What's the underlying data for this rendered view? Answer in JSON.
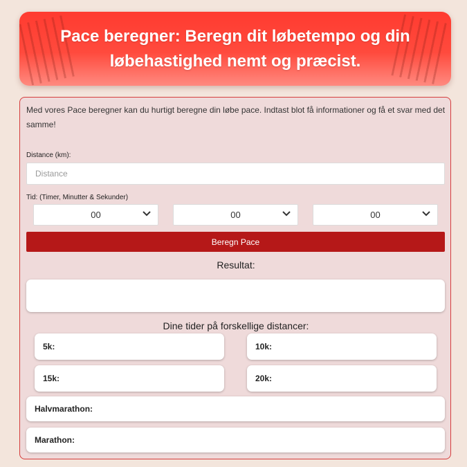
{
  "header": {
    "title": "Pace beregner: Beregn dit løbetempo og din løbehastighed nemt og præcist."
  },
  "intro": "Med vores Pace beregner kan du hurtigt beregne din løbe pace. Indtast blot få informationer og få et svar med det samme!",
  "form": {
    "distance_label": "Distance (km):",
    "distance_placeholder": "Distance",
    "time_label": "Tid: (Timer, Minutter & Sekunder)",
    "hours_value": "00",
    "minutes_value": "00",
    "seconds_value": "00",
    "submit_label": "Beregn Pace"
  },
  "result": {
    "heading": "Resultat:"
  },
  "distances": {
    "heading": "Dine tider på forskellige distancer:",
    "k5": "5k:",
    "k10": "10k:",
    "k15": "15k:",
    "k20": "20k:",
    "half": "Halvmarathon:",
    "marathon": "Marathon:"
  },
  "colors": {
    "header": "#ff3b30",
    "button": "#b51818",
    "panel_border": "#d53c3c",
    "panel_bg": "#efdada",
    "page_bg": "#f3e5dc"
  },
  "icons": {
    "select_arrow": "chevron-down-icon"
  }
}
